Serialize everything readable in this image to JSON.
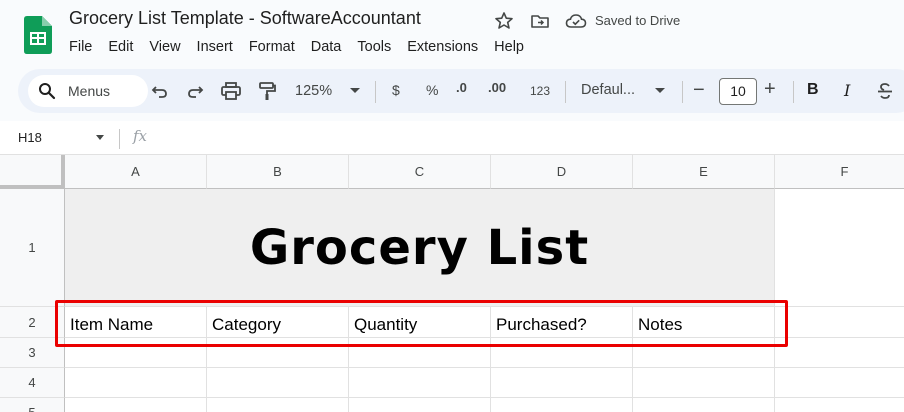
{
  "app": {
    "title": "Grocery List Template - SoftwareAccountant",
    "saved_status": "Saved to Drive",
    "menu": [
      "File",
      "Edit",
      "View",
      "Insert",
      "Format",
      "Data",
      "Tools",
      "Extensions",
      "Help"
    ]
  },
  "toolbar": {
    "search_label": "Menus",
    "zoom": "125%",
    "currency": "$",
    "percent": "%",
    "decrease_decimals": ".0",
    "increase_decimals": ".00",
    "number_format": "123",
    "font": "Defaul...",
    "font_size": "10",
    "minus": "−",
    "plus": "+",
    "bold": "B",
    "italic": "I"
  },
  "formula_bar": {
    "cell_ref": "H18",
    "fx_label": "fx",
    "value": ""
  },
  "sheet": {
    "columns": [
      "A",
      "B",
      "C",
      "D",
      "E",
      "F"
    ],
    "rows": [
      "1",
      "2",
      "3",
      "4",
      "5"
    ],
    "title": "Grocery List",
    "headers": [
      "Item Name",
      "Category",
      "Quantity",
      "Purchased?",
      "Notes"
    ]
  },
  "colors": {
    "highlight": "#ea0000",
    "title_fill": "#efefef",
    "sheets_green": "#0f9d58"
  },
  "icons": [
    "sheets-logo",
    "star-icon",
    "move-folder-icon",
    "cloud-saved-icon",
    "search-icon",
    "undo-icon",
    "redo-icon",
    "print-icon",
    "paint-format-icon",
    "chevron-down-icon",
    "strikethrough-icon"
  ]
}
